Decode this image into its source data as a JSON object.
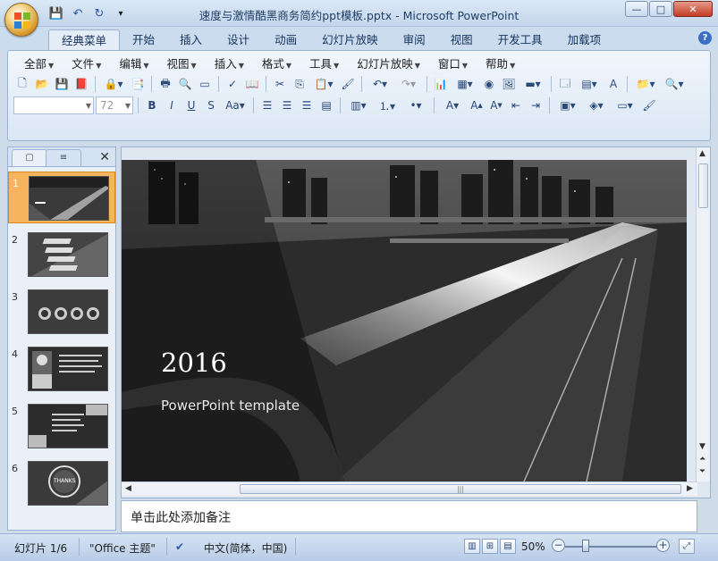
{
  "window": {
    "title": "速度与激情酷黑商务简约ppt模板.pptx - Microsoft PowerPoint",
    "controls": {
      "minimize": "—",
      "maximize": "□",
      "close": "✕"
    }
  },
  "qat": {
    "save": "💾",
    "undo": "↶",
    "redo": "↻",
    "customize": "▾"
  },
  "ribbon": {
    "tabs": [
      "经典菜单",
      "开始",
      "插入",
      "设计",
      "动画",
      "幻灯片放映",
      "审阅",
      "视图",
      "开发工具",
      "加载项"
    ],
    "active_tab": 0,
    "help": "?",
    "menus": [
      "全部",
      "文件",
      "编辑",
      "视图",
      "插入",
      "格式",
      "工具",
      "幻灯片放映",
      "窗口",
      "帮助"
    ],
    "font_size_value": "72",
    "font_name_value": ""
  },
  "left_panel": {
    "tab_slides": "▢",
    "tab_outline": "≡",
    "close": "✕",
    "thumbnails": [
      {
        "num": "1",
        "caption": ""
      },
      {
        "num": "2",
        "caption": ""
      },
      {
        "num": "3",
        "caption": ""
      },
      {
        "num": "4",
        "caption": ""
      },
      {
        "num": "5",
        "caption": ""
      },
      {
        "num": "6",
        "caption": "THANKS"
      }
    ],
    "selected": 0
  },
  "slide": {
    "year": "2016",
    "subtitle": "PowerPoint template"
  },
  "notes": {
    "placeholder": "单击此处添加备注"
  },
  "status": {
    "slide_counter": "幻灯片 1/6",
    "theme": "\"Office 主题\"",
    "language": "中文(简体，中国)",
    "zoom": "50%",
    "zoom_level_percent": 50
  },
  "colors": {
    "title_text": "#1f3e66",
    "thumb_selected": "#f6b55d"
  }
}
